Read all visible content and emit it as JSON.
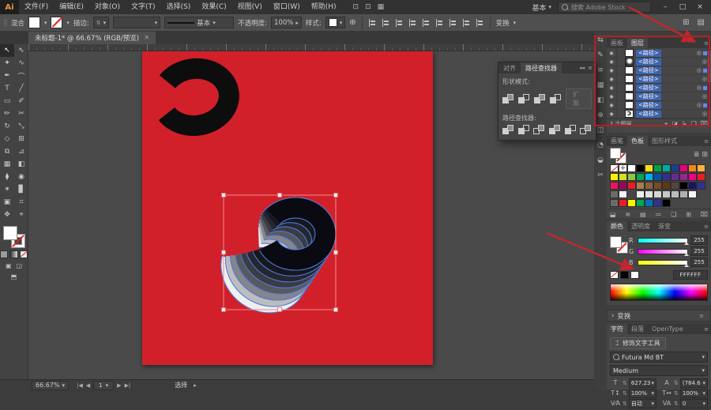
{
  "titlebar": {
    "logo": "Ai",
    "menu": [
      "文件(F)",
      "编辑(E)",
      "对象(O)",
      "文字(T)",
      "选择(S)",
      "效果(C)",
      "视图(V)",
      "窗口(W)",
      "帮助(H)"
    ],
    "app_icons": [
      {
        "name": "stock-icon",
        "glyph": "⊡"
      },
      {
        "name": "share-icon",
        "glyph": "⊡"
      },
      {
        "name": "arrange-docs-icon",
        "glyph": "▦"
      }
    ],
    "workspace": "基本",
    "search_placeholder": "搜索 Adobe Stock",
    "window": {
      "min": "–",
      "max": "□",
      "close": "×"
    }
  },
  "options": {
    "context_label": "混合",
    "stroke_label": "描边:",
    "brush_definition": "基本",
    "opacity_label": "不透明度:",
    "opacity_value": "100%",
    "style_label": "样式:",
    "transform_label": "变换",
    "align_icons": [
      "align-left-icon",
      "align-center-h-icon",
      "align-right-icon",
      "align-top-icon",
      "align-middle-v-icon",
      "align-bottom-icon",
      "distribute-left-icon",
      "distribute-center-icon",
      "distribute-right-icon"
    ],
    "right_icons": [
      {
        "name": "document-setup-icon",
        "glyph": "⊞"
      },
      {
        "name": "preferences-icon",
        "glyph": "▤"
      }
    ]
  },
  "doc_tab": {
    "title": "未标题-1* @ 66.67% (RGB/预览)",
    "close": "×"
  },
  "tools": [
    {
      "name": "selection-tool",
      "glyph": "↖",
      "active": true
    },
    {
      "name": "direct-selection-tool",
      "glyph": "⇖",
      "active": false
    },
    {
      "name": "magic-wand-tool",
      "glyph": "✦",
      "active": false
    },
    {
      "name": "lasso-tool",
      "glyph": "∿",
      "active": false
    },
    {
      "name": "pen-tool",
      "glyph": "✒",
      "active": false
    },
    {
      "name": "curvature-tool",
      "glyph": "⌒",
      "active": false
    },
    {
      "name": "type-tool",
      "glyph": "T",
      "active": false
    },
    {
      "name": "line-segment-tool",
      "glyph": "╱",
      "active": false
    },
    {
      "name": "rectangle-tool",
      "glyph": "▭",
      "active": false
    },
    {
      "name": "paintbrush-tool",
      "glyph": "✐",
      "active": false
    },
    {
      "name": "pencil-tool",
      "glyph": "✏",
      "active": false
    },
    {
      "name": "scissors-tool",
      "glyph": "✂",
      "active": false
    },
    {
      "name": "rotate-tool",
      "glyph": "↻",
      "active": false
    },
    {
      "name": "scale-tool",
      "glyph": "⤡",
      "active": false
    },
    {
      "name": "width-tool",
      "glyph": "◇",
      "active": false
    },
    {
      "name": "free-transform-tool",
      "glyph": "⊞",
      "active": false
    },
    {
      "name": "shape-builder-tool",
      "glyph": "⧉",
      "active": false
    },
    {
      "name": "perspective-grid-tool",
      "glyph": "⊿",
      "active": false
    },
    {
      "name": "mesh-tool",
      "glyph": "▦",
      "active": false
    },
    {
      "name": "gradient-tool",
      "glyph": "◧",
      "active": false
    },
    {
      "name": "eyedropper-tool",
      "glyph": "⧫",
      "active": false
    },
    {
      "name": "blend-tool",
      "glyph": "◉",
      "active": false
    },
    {
      "name": "symbol-sprayer-tool",
      "glyph": "✶",
      "active": false
    },
    {
      "name": "column-graph-tool",
      "glyph": "▊",
      "active": false
    },
    {
      "name": "artboard-tool",
      "glyph": "▣",
      "active": false
    },
    {
      "name": "slice-tool",
      "glyph": "⌗",
      "active": false
    },
    {
      "name": "hand-tool",
      "glyph": "✥",
      "active": false
    },
    {
      "name": "zoom-tool",
      "glyph": "⌖",
      "active": false
    }
  ],
  "canvas": {
    "artboard_color": "#d2202a",
    "selection_color": "#f08a8a",
    "blend": {
      "steps": 8,
      "colors": [
        "#0a0a12",
        "#17171e",
        "#262630",
        "#3b3b44",
        "#58585f",
        "#85858a",
        "#bdbdc0",
        "#efefef"
      ],
      "edge_color": "#4e79d6"
    },
    "shape_color": "#0d0d0d"
  },
  "pathfinder_panel": {
    "tabs": [
      {
        "label": "对齐",
        "active": false
      },
      {
        "label": "路径查找器",
        "active": true
      }
    ],
    "collapse_icon": "◂◂",
    "menu_icon": "≡",
    "shape_modes_label": "形状模式:",
    "shape_mode_icons": [
      "unite-icon",
      "minus-front-icon",
      "intersect-icon",
      "exclude-icon"
    ],
    "expand_label": "扩展",
    "pathfinders_label": "路径查找器:",
    "pathfinder_icons": [
      "divide-icon",
      "trim-icon",
      "merge-icon",
      "crop-icon",
      "outline-icon",
      "minus-back-icon"
    ]
  },
  "dock_icons": [
    {
      "name": "swap-panels-icon",
      "glyph": "⇆"
    },
    {
      "name": "brushes-panel-icon",
      "glyph": "✎"
    },
    {
      "name": "stroke-panel-icon",
      "glyph": "≡"
    },
    {
      "name": "pathfinder-panel-icon",
      "glyph": "▦"
    },
    {
      "name": "gradient-panel-icon",
      "glyph": "◧"
    },
    {
      "name": "symbols-panel-icon",
      "glyph": "⊕"
    },
    {
      "name": "transparency-panel-icon",
      "glyph": "◫"
    },
    {
      "name": "appearance-panel-icon",
      "glyph": "◔"
    },
    {
      "name": "graphic-styles-panel-icon",
      "glyph": "◒"
    },
    {
      "name": "links-panel-icon",
      "glyph": "✂"
    }
  ],
  "layers_panel": {
    "tabs": [
      {
        "label": "画板",
        "active": false
      },
      {
        "label": "图层",
        "active": true
      }
    ],
    "rows": [
      {
        "label": "<路径>",
        "thumb": "white",
        "selected": true
      },
      {
        "label": "<路径>",
        "thumb": "blend",
        "selected": false
      },
      {
        "label": "<路径>",
        "thumb": "white",
        "selected": true
      },
      {
        "label": "<路径>",
        "thumb": "white",
        "selected": false
      },
      {
        "label": "<路径>",
        "thumb": "white",
        "selected": true
      },
      {
        "label": "<路径>",
        "thumb": "white",
        "selected": false
      },
      {
        "label": "<路径>",
        "thumb": "white",
        "selected": true
      },
      {
        "label": "<路径>",
        "thumb": "blackc",
        "selected": false
      }
    ],
    "row_glyphs": {
      "eye": "◉",
      "target": "◎",
      "black_thumb": "Ɔ"
    },
    "footer_text": "1 个图层",
    "footer_icons": [
      {
        "name": "locate-object-icon",
        "glyph": "⌖"
      },
      {
        "name": "make-clip-mask-icon",
        "glyph": "◪"
      },
      {
        "name": "new-sublayer-icon",
        "glyph": "↳"
      },
      {
        "name": "new-layer-icon",
        "glyph": "❏"
      },
      {
        "name": "delete-layer-icon",
        "glyph": "⌧"
      }
    ]
  },
  "swatches_panel": {
    "tabs": [
      {
        "label": "画笔",
        "active": false
      },
      {
        "label": "色板",
        "active": true
      },
      {
        "label": "图形样式",
        "active": false
      }
    ],
    "view_icons": [
      {
        "name": "list-view-icon",
        "glyph": "≣"
      },
      {
        "name": "grid-view-icon",
        "glyph": "⊞"
      }
    ],
    "grid": [
      [
        "none",
        "reg",
        "#ffffff",
        "#000000",
        "#ffde17",
        "#00a14b",
        "#00a99d",
        "#1b3f8f",
        "#e6007e",
        "#f58220",
        "#fbb040"
      ],
      [
        "#fff200",
        "#d7df23",
        "#8dc63f",
        "#00a651",
        "#00aeef",
        "#0054a6",
        "#2e3192",
        "#662d91",
        "#92278f",
        "#ec008c",
        "#ed1c24"
      ],
      [
        "#ed145b",
        "#9e005d",
        "#ed1c24",
        "#a97c50",
        "#8c6239",
        "#754c24",
        "#603913",
        "#534741",
        "#000000",
        "#1b1464",
        "#2e3192"
      ],
      [
        "group",
        "#f5f5f5",
        "empty",
        "#eeeeee",
        "#e0e0e0",
        "#d4d4d4",
        "#c8c8c8",
        "#bcbcbc",
        "#b0b0b0",
        "#f8f8f8",
        "empty"
      ],
      [
        "group",
        "#ed1c24",
        "#fff200",
        "#00a651",
        "#0072bc",
        "#2e3192",
        "#000000",
        "empty",
        "empty",
        "empty",
        "empty"
      ]
    ],
    "footer_icons": [
      {
        "name": "swatch-libraries-icon",
        "glyph": "⬓"
      },
      {
        "name": "color-themes-icon",
        "glyph": "≋"
      },
      {
        "name": "swatch-kinds-icon",
        "glyph": "▤"
      },
      {
        "name": "swatch-options-icon",
        "glyph": "≔"
      },
      {
        "name": "new-color-group-icon",
        "glyph": "❏"
      },
      {
        "name": "new-swatch-icon",
        "glyph": "⊞"
      },
      {
        "name": "delete-swatch-icon",
        "glyph": "⌧"
      }
    ]
  },
  "color_panel": {
    "tabs": [
      {
        "label": "颜色",
        "active": true
      },
      {
        "label": "透明度",
        "active": false
      },
      {
        "label": "渐变",
        "active": false
      }
    ],
    "channels": [
      {
        "label": "R",
        "value": "255",
        "grad": "r"
      },
      {
        "label": "G",
        "value": "255",
        "grad": "g"
      },
      {
        "label": "B",
        "value": "255",
        "grad": "b"
      }
    ],
    "hex": "FFFFFF"
  },
  "transform_header": {
    "label": "变换",
    "caret": "›",
    "menu_icon": "≡"
  },
  "character_panel": {
    "tabs": [
      {
        "label": "字符",
        "active": true
      },
      {
        "label": "段落",
        "active": false
      },
      {
        "label": "OpenType",
        "active": false
      }
    ],
    "touch_tool_label": "修饰文字工具",
    "touch_tool_icon": "⌶",
    "font_name": "Futura Md BT",
    "font_style": "Medium",
    "rows": [
      {
        "icon_name": "font-size-icon",
        "icon": "T",
        "stepper": "⇅",
        "value": "627.23"
      },
      {
        "icon_name": "leading-icon",
        "icon": "A",
        "stepper": "⇅",
        "value": "(784.6"
      },
      {
        "icon_name": "vertical-scale-icon",
        "icon": "T↕",
        "stepper": "⇅",
        "value": "100%"
      },
      {
        "icon_name": "horizontal-scale-icon",
        "icon": "T↔",
        "stepper": "⇅",
        "value": "100%"
      },
      {
        "icon_name": "kerning-icon",
        "icon": "V⁄A",
        "stepper": "⇅",
        "value": "自动"
      },
      {
        "icon_name": "tracking-icon",
        "icon": "VA",
        "stepper": "⇅",
        "value": "0"
      }
    ]
  },
  "statusbar": {
    "zoom": "66.67%",
    "nav_icons": [
      "|◀",
      "◀",
      "▶",
      "▶|"
    ],
    "artboard_number": "1",
    "tool_label": "选择",
    "tool_caret": "▸"
  }
}
